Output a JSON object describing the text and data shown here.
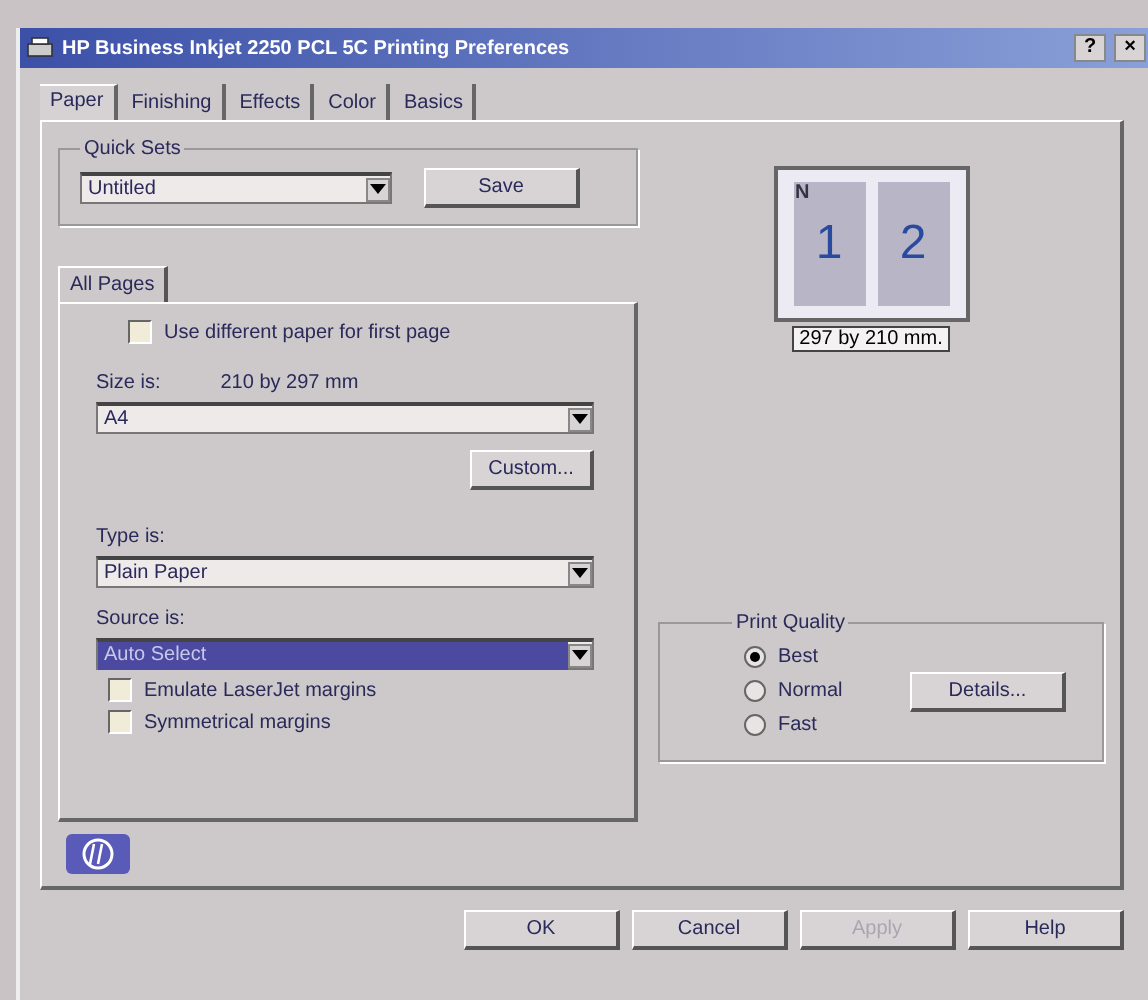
{
  "window": {
    "title": "HP Business Inkjet 2250 PCL 5C Printing Preferences",
    "help": "?",
    "close": "×"
  },
  "tabs": [
    {
      "label": "Paper",
      "selected": true
    },
    {
      "label": "Finishing",
      "selected": false
    },
    {
      "label": "Effects",
      "selected": false
    },
    {
      "label": "Color",
      "selected": false
    },
    {
      "label": "Basics",
      "selected": false
    }
  ],
  "quick_sets": {
    "label": "Quick Sets",
    "value": "Untitled",
    "save": "Save"
  },
  "all_pages": {
    "tab": "All Pages",
    "different_first": {
      "label": "Use different paper for first page",
      "checked": false
    },
    "size_label": "Size is:",
    "size_dims": "210 by 297 mm",
    "size": "A4",
    "custom": "Custom...",
    "type_label": "Type is:",
    "type": "Plain Paper",
    "source_label": "Source is:",
    "source": "Auto Select",
    "source_focused": true,
    "options": [
      {
        "label": "Emulate LaserJet margins",
        "checked": false
      },
      {
        "label": "Symmetrical margins",
        "checked": false
      }
    ]
  },
  "preview": {
    "corner": "N",
    "pages": [
      "1",
      "2"
    ],
    "caption": "297 by 210 mm."
  },
  "print_quality": {
    "label": "Print Quality",
    "options": [
      {
        "label": "Best",
        "selected": true
      },
      {
        "label": "Normal",
        "selected": false
      },
      {
        "label": "Fast",
        "selected": false
      }
    ],
    "details": "Details..."
  },
  "buttons": [
    {
      "label": "OK",
      "disabled": false
    },
    {
      "label": "Cancel",
      "disabled": false
    },
    {
      "label": "Apply",
      "disabled": true
    },
    {
      "label": "Help",
      "disabled": false
    }
  ]
}
